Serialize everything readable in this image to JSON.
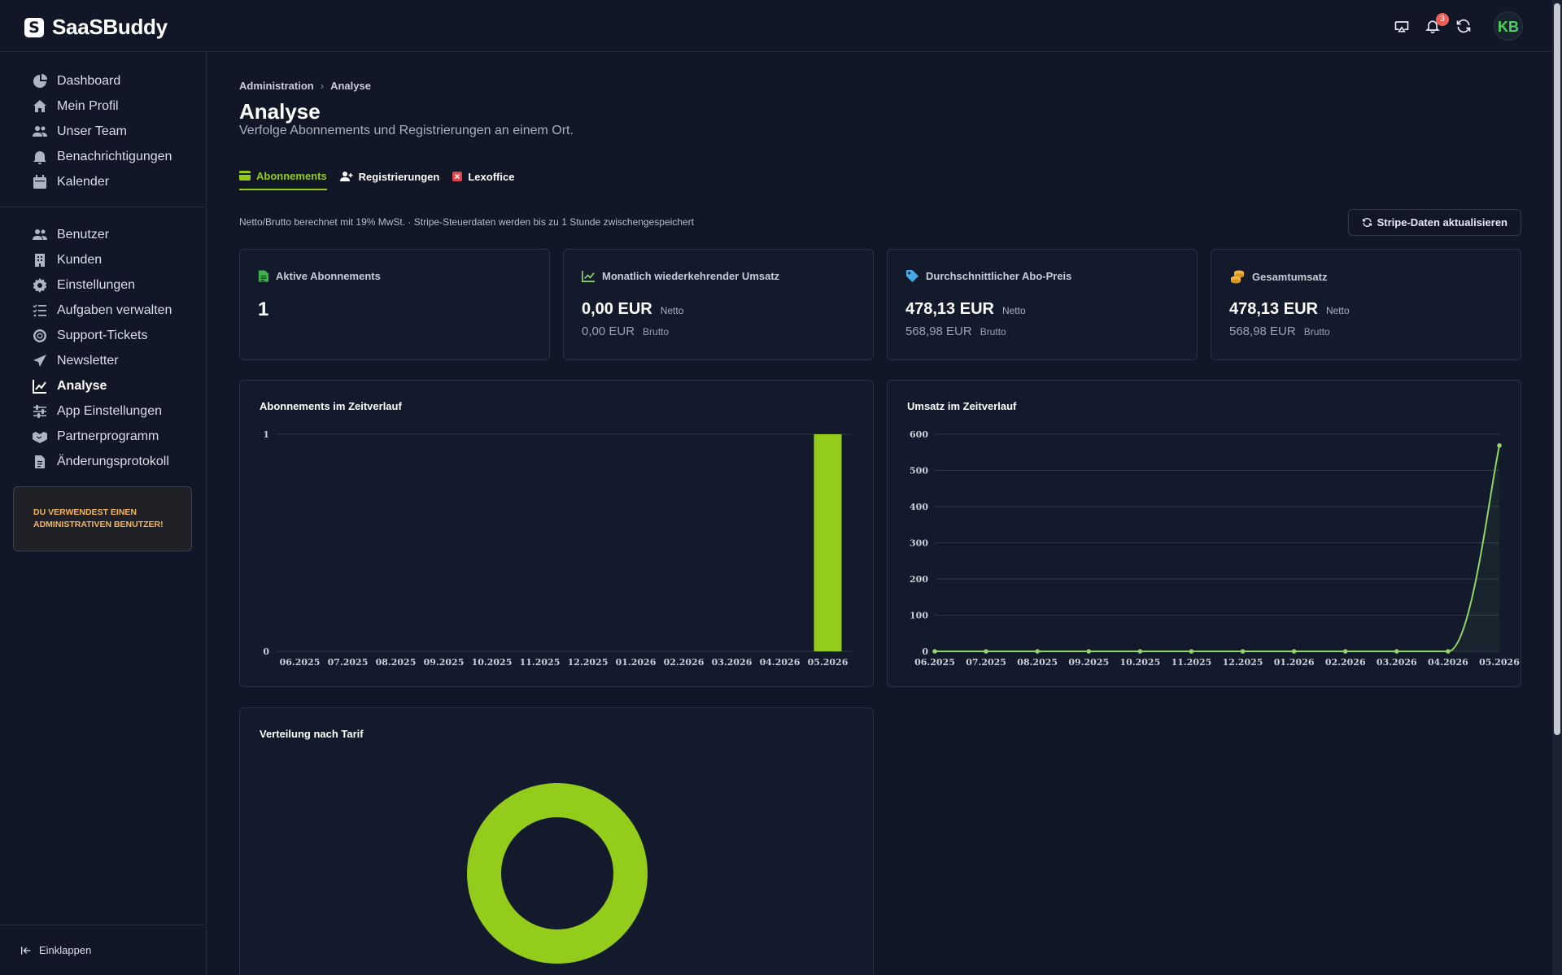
{
  "app": {
    "name": "SaaSBuddy",
    "logo_letter": "S",
    "notifications_count": "3",
    "avatar_initials": "KB"
  },
  "sidebar": {
    "group1": [
      {
        "label": "Dashboard",
        "icon": "pie-chart-icon"
      },
      {
        "label": "Mein Profil",
        "icon": "home-icon"
      },
      {
        "label": "Unser Team",
        "icon": "users-icon"
      },
      {
        "label": "Benachrichtigungen",
        "icon": "bell-icon"
      },
      {
        "label": "Kalender",
        "icon": "calendar-icon"
      }
    ],
    "group2": [
      {
        "label": "Benutzer",
        "icon": "users-icon"
      },
      {
        "label": "Kunden",
        "icon": "building-icon"
      },
      {
        "label": "Einstellungen",
        "icon": "gear-icon"
      },
      {
        "label": "Aufgaben verwalten",
        "icon": "list-check-icon"
      },
      {
        "label": "Support-Tickets",
        "icon": "lifebuoy-icon"
      },
      {
        "label": "Newsletter",
        "icon": "paper-plane-icon"
      },
      {
        "label": "Analyse",
        "icon": "line-chart-icon",
        "active": true
      },
      {
        "label": "App Einstellungen",
        "icon": "sliders-icon"
      },
      {
        "label": "Partnerprogramm",
        "icon": "handshake-icon"
      },
      {
        "label": "Änderungsprotokoll",
        "icon": "file-icon"
      }
    ],
    "admin_notice": "DU VERWENDEST EINEN ADMINISTRATIVEN BENUTZER!",
    "collapse_label": "Einklappen"
  },
  "header": {
    "breadcrumb": [
      "Administration",
      "Analyse"
    ],
    "title": "Analyse",
    "subtitle": "Verfolge Abonnements und Registrierungen an einem Ort."
  },
  "tabs": [
    {
      "label": "Abonnements",
      "active": true,
      "icon": "credit-card-icon"
    },
    {
      "label": "Registrierungen",
      "active": false,
      "icon": "user-plus-icon"
    },
    {
      "label": "Lexoffice",
      "active": false,
      "icon": "x-square-icon"
    }
  ],
  "info_line": "Netto/Brutto berechnet mit 19% MwSt. · Stripe-Steuerdaten werden bis zu 1 Stunde zwischengespeichert",
  "refresh_button": "Stripe-Daten aktualisieren",
  "stats": {
    "active_subs": {
      "title": "Aktive Abonnements",
      "value": "1"
    },
    "mrr": {
      "title": "Monatlich wiederkehrender Umsatz",
      "net": "0,00 EUR",
      "gross": "0,00 EUR",
      "net_label": "Netto",
      "gross_label": "Brutto"
    },
    "avg_price": {
      "title": "Durchschnittlicher Abo-Preis",
      "net": "478,13 EUR",
      "gross": "568,98 EUR",
      "net_label": "Netto",
      "gross_label": "Brutto"
    },
    "total": {
      "title": "Gesamtumsatz",
      "net": "478,13 EUR",
      "gross": "568,98 EUR",
      "net_label": "Netto",
      "gross_label": "Brutto"
    }
  },
  "colors": {
    "accent": "#93cc1a",
    "line": "#8fd66b"
  },
  "chart_data": [
    {
      "type": "bar",
      "title": "Abonnements im Zeitverlauf",
      "categories": [
        "06.2025",
        "07.2025",
        "08.2025",
        "09.2025",
        "10.2025",
        "11.2025",
        "12.2025",
        "01.2026",
        "02.2026",
        "03.2026",
        "04.2026",
        "05.2026"
      ],
      "values": [
        0,
        0,
        0,
        0,
        0,
        0,
        0,
        0,
        0,
        0,
        0,
        1
      ],
      "ylim": [
        0,
        1
      ],
      "yticks": [
        0,
        1
      ],
      "grid": true
    },
    {
      "type": "line",
      "title": "Umsatz im Zeitverlauf",
      "categories": [
        "06.2025",
        "07.2025",
        "08.2025",
        "09.2025",
        "10.2025",
        "11.2025",
        "12.2025",
        "01.2026",
        "02.2026",
        "03.2026",
        "04.2026",
        "05.2026"
      ],
      "values": [
        0,
        0,
        0,
        0,
        0,
        0,
        0,
        0,
        0,
        0,
        0,
        569
      ],
      "ylim": [
        0,
        600
      ],
      "yticks": [
        0,
        100,
        200,
        300,
        400,
        500,
        600
      ],
      "grid": true
    },
    {
      "type": "pie",
      "title": "Verteilung nach Tarif",
      "values": [
        1
      ]
    }
  ]
}
